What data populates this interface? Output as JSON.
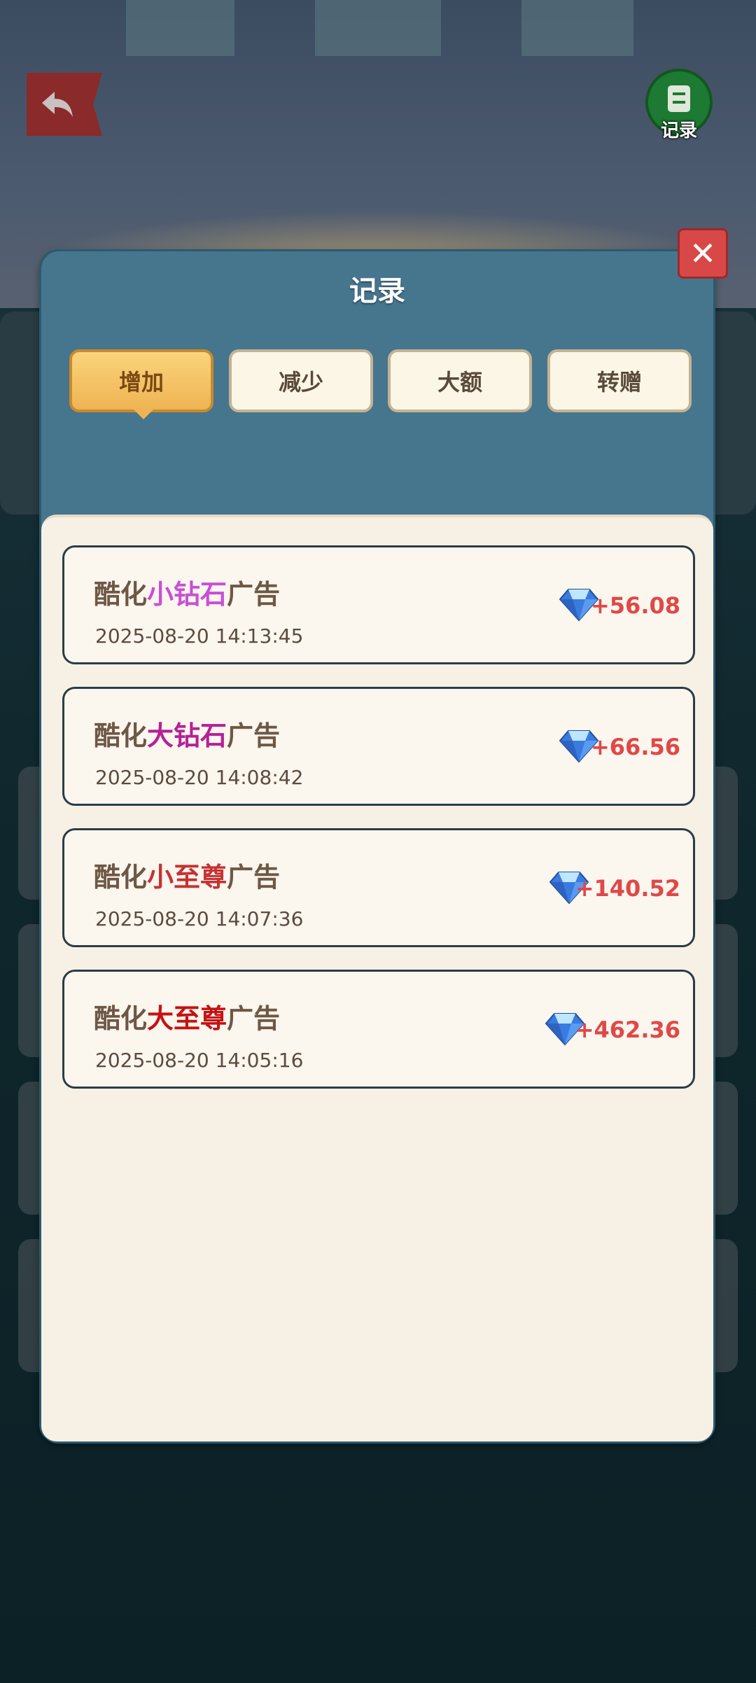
{
  "hud": {
    "record_button_label": "记录"
  },
  "modal": {
    "title": "记录",
    "close_symbol": "✕",
    "tabs": [
      {
        "label": "增加",
        "active": true
      },
      {
        "label": "减少",
        "active": false
      },
      {
        "label": "大额",
        "active": false
      },
      {
        "label": "转赠",
        "active": false
      }
    ],
    "records": [
      {
        "title_prefix": "酷化",
        "title_highlight": "小钻石",
        "title_suffix": "广告",
        "highlight_color": "#c94fd6",
        "time": "2025-08-20 14:13:45",
        "amount": "+56.08"
      },
      {
        "title_prefix": "酷化",
        "title_highlight": "大钻石",
        "title_suffix": "广告",
        "highlight_color": "#b42196",
        "time": "2025-08-20 14:08:42",
        "amount": "+66.56"
      },
      {
        "title_prefix": "酷化",
        "title_highlight": "小至尊",
        "title_suffix": "广告",
        "highlight_color": "#c53232",
        "time": "2025-08-20 14:07:36",
        "amount": "+140.52"
      },
      {
        "title_prefix": "酷化",
        "title_highlight": "大至尊",
        "title_suffix": "广告",
        "highlight_color": "#c41212",
        "time": "2025-08-20 14:05:16",
        "amount": "+462.36"
      }
    ]
  },
  "colors": {
    "amount": "#e04848",
    "active_tab": "#eeb453",
    "modal_header": "#46758e"
  },
  "icons": {
    "back": "back-arrow-icon",
    "record": "notepad-icon",
    "currency": "blue-diamond-icon",
    "close": "close-icon"
  }
}
